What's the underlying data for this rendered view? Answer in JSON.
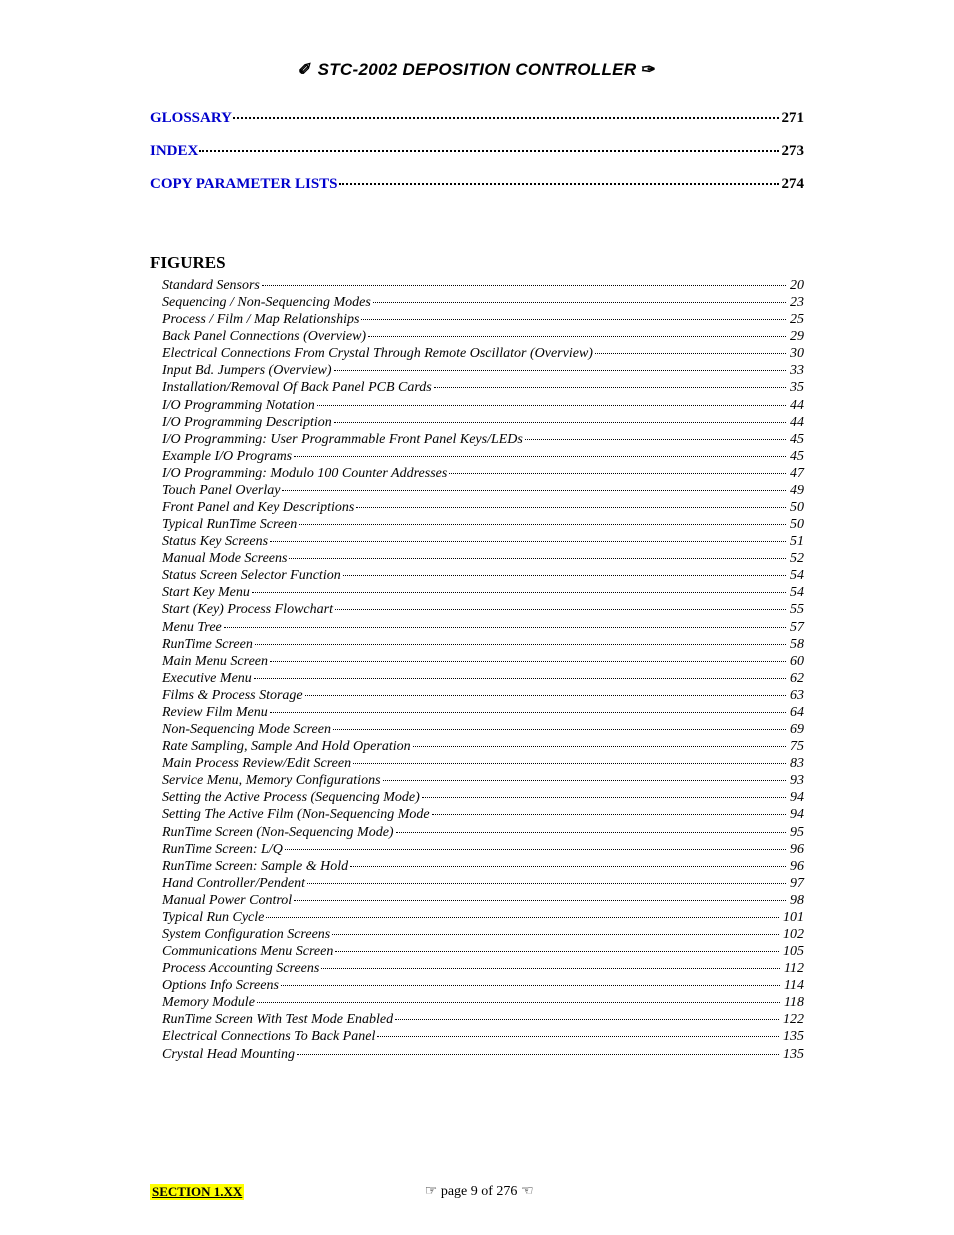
{
  "header": {
    "left_glyph": "✐",
    "title": "STC-2002  DEPOSITION CONTROLLER",
    "right_glyph": "✑"
  },
  "toc_main": [
    {
      "label": "GLOSSARY",
      "page": "271"
    },
    {
      "label": "INDEX",
      "page": "273"
    },
    {
      "label": "COPY PARAMETER LISTS",
      "page": "274"
    }
  ],
  "figures_heading": "FIGURES",
  "figures": [
    {
      "label": "Standard Sensors",
      "page": "20"
    },
    {
      "label": "Sequencing / Non-Sequencing Modes",
      "page": "23"
    },
    {
      "label": "Process / Film / Map Relationships",
      "page": "25"
    },
    {
      "label": "Back Panel Connections (Overview)",
      "page": "29"
    },
    {
      "label": "Electrical Connections From Crystal Through Remote Oscillator (Overview)",
      "page": "30"
    },
    {
      "label": "Input Bd. Jumpers (Overview)",
      "page": "33"
    },
    {
      "label": "Installation/Removal Of Back Panel PCB Cards",
      "page": "35"
    },
    {
      "label": "I/O Programming Notation",
      "page": "44"
    },
    {
      "label": "I/O Programming Description",
      "page": "44"
    },
    {
      "label": "I/O Programming: User Programmable Front Panel Keys/LEDs",
      "page": "45"
    },
    {
      "label": "Example I/O Programs",
      "page": "45"
    },
    {
      "label": "I/O Programming: Modulo 100 Counter Addresses",
      "page": "47"
    },
    {
      "label": "Touch Panel Overlay",
      "page": "49"
    },
    {
      "label": "Front Panel and Key Descriptions",
      "page": "50"
    },
    {
      "label": "Typical RunTime Screen",
      "page": "50"
    },
    {
      "label": "Status Key Screens",
      "page": "51"
    },
    {
      "label": "Manual Mode Screens",
      "page": "52"
    },
    {
      "label": "Status Screen Selector Function",
      "page": "54"
    },
    {
      "label": "Start Key Menu",
      "page": "54"
    },
    {
      "label": "Start (Key) Process Flowchart",
      "page": "55"
    },
    {
      "label": "Menu Tree",
      "page": "57"
    },
    {
      "label": "RunTime Screen",
      "page": "58"
    },
    {
      "label": "Main Menu Screen",
      "page": "60"
    },
    {
      "label": "Executive Menu",
      "page": "62"
    },
    {
      "label": "Films & Process Storage",
      "page": "63"
    },
    {
      "label": "Review Film Menu",
      "page": "64"
    },
    {
      "label": "Non-Sequencing Mode Screen",
      "page": "69"
    },
    {
      "label": "Rate Sampling, Sample And Hold Operation",
      "page": "75"
    },
    {
      "label": "Main Process Review/Edit Screen",
      "page": "83"
    },
    {
      "label": "Service Menu, Memory Configurations",
      "page": "93"
    },
    {
      "label": "Setting the Active Process (Sequencing Mode)",
      "page": "94"
    },
    {
      "label": "Setting The Active Film (Non-Sequencing Mode",
      "page": "94"
    },
    {
      "label": "RunTime Screen (Non-Sequencing Mode)",
      "page": "95"
    },
    {
      "label": "RunTime Screen: L/Q",
      "page": "96"
    },
    {
      "label": "RunTime Screen: Sample & Hold",
      "page": "96"
    },
    {
      "label": "Hand Controller/Pendent",
      "page": "97"
    },
    {
      "label": "Manual Power Control",
      "page": "98"
    },
    {
      "label": "Typical Run Cycle",
      "page": "101"
    },
    {
      "label": "System Configuration Screens",
      "page": "102"
    },
    {
      "label": "Communications Menu Screen",
      "page": "105"
    },
    {
      "label": "Process Accounting Screens",
      "page": "112"
    },
    {
      "label": "Options Info Screens",
      "page": "114"
    },
    {
      "label": "Memory Module",
      "page": "118"
    },
    {
      "label": "RunTime Screen With Test Mode Enabled",
      "page": "122"
    },
    {
      "label": "Electrical Connections To Back Panel",
      "page": "135"
    },
    {
      "label": "Crystal Head Mounting",
      "page": "135"
    }
  ],
  "footer": {
    "section": "SECTION 1.XX",
    "left_glyph": "☞",
    "text": "page 9 of 276",
    "right_glyph": "☜"
  }
}
